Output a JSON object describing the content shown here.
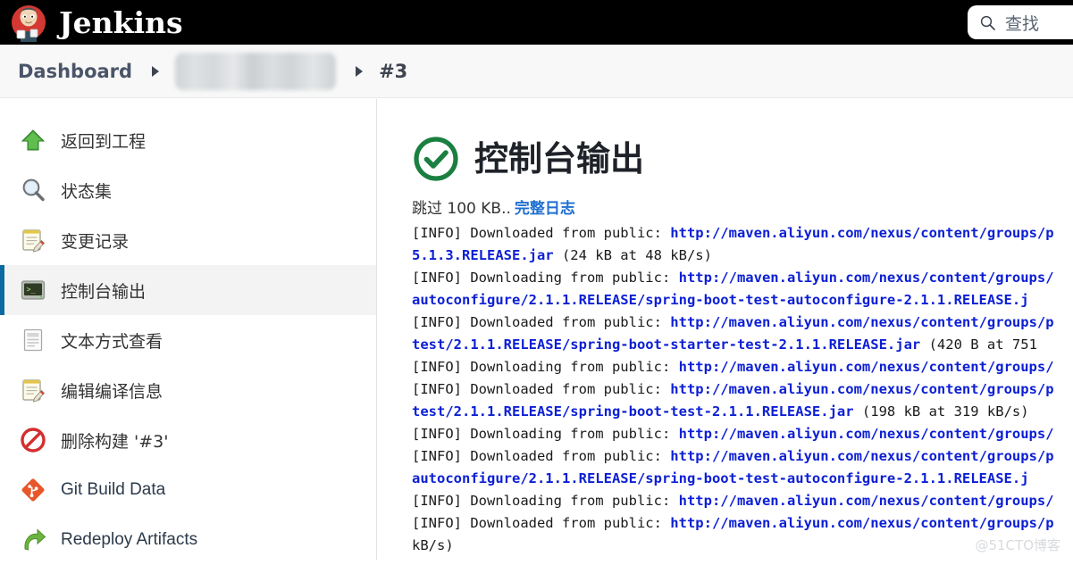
{
  "header": {
    "brand_title": "Jenkins",
    "logo_icon": "jenkins-butler-logo",
    "search_icon": "search-icon",
    "search_placeholder": "查找"
  },
  "breadcrumb": {
    "dashboard_label": "Dashboard",
    "project_label": "",
    "build_label": "#3"
  },
  "sidebar": {
    "items": [
      {
        "label": "返回到工程",
        "icon": "up-arrow-icon",
        "active": false
      },
      {
        "label": "状态集",
        "icon": "magnifier-icon",
        "active": false
      },
      {
        "label": "变更记录",
        "icon": "notepad-pencil-icon",
        "active": false
      },
      {
        "label": "控制台输出",
        "icon": "terminal-icon",
        "active": true
      },
      {
        "label": "文本方式查看",
        "icon": "document-icon",
        "active": false
      },
      {
        "label": "编辑编译信息",
        "icon": "notepad-pencil-icon",
        "active": false
      },
      {
        "label": "删除构建 '#3'",
        "icon": "no-entry-icon",
        "active": false
      },
      {
        "label": "Git Build Data",
        "icon": "git-diamond-icon",
        "active": false
      },
      {
        "label": "Redeploy Artifacts",
        "icon": "redeploy-arrow-icon",
        "active": false
      }
    ]
  },
  "console": {
    "status_icon": "success-check-circle-icon",
    "title": "控制台输出",
    "skip_text": "跳过 100 KB..",
    "full_log_label": "完整日志",
    "lines": [
      {
        "prefix": "[INFO] Downloaded from public: ",
        "url": "http://maven.aliyun.com/nexus/content/groups/p",
        "suffix": ""
      },
      {
        "prefix": "",
        "url": "5.1.3.RELEASE.jar",
        "suffix": " (24 kB at 48 kB/s)"
      },
      {
        "prefix": "[INFO] Downloading from public: ",
        "url": "http://maven.aliyun.com/nexus/content/groups/",
        "suffix": ""
      },
      {
        "prefix": "",
        "url": "autoconfigure/2.1.1.RELEASE/spring-boot-test-autoconfigure-2.1.1.RELEASE.j",
        "suffix": ""
      },
      {
        "prefix": "[INFO] Downloaded from public: ",
        "url": "http://maven.aliyun.com/nexus/content/groups/p",
        "suffix": ""
      },
      {
        "prefix": "",
        "url": "test/2.1.1.RELEASE/spring-boot-starter-test-2.1.1.RELEASE.jar",
        "suffix": " (420 B at 751"
      },
      {
        "prefix": "[INFO] Downloading from public: ",
        "url": "http://maven.aliyun.com/nexus/content/groups/",
        "suffix": ""
      },
      {
        "prefix": "[INFO] Downloaded from public: ",
        "url": "http://maven.aliyun.com/nexus/content/groups/p",
        "suffix": ""
      },
      {
        "prefix": "",
        "url": "test/2.1.1.RELEASE/spring-boot-test-2.1.1.RELEASE.jar",
        "suffix": " (198 kB at 319 kB/s)"
      },
      {
        "prefix": "[INFO] Downloading from public: ",
        "url": "http://maven.aliyun.com/nexus/content/groups/",
        "suffix": ""
      },
      {
        "prefix": "[INFO] Downloaded from public: ",
        "url": "http://maven.aliyun.com/nexus/content/groups/p",
        "suffix": ""
      },
      {
        "prefix": "",
        "url": "autoconfigure/2.1.1.RELEASE/spring-boot-test-autoconfigure-2.1.1.RELEASE.j",
        "suffix": ""
      },
      {
        "prefix": "[INFO] Downloading from public: ",
        "url": "http://maven.aliyun.com/nexus/content/groups/",
        "suffix": ""
      },
      {
        "prefix": "[INFO] Downloaded from public: ",
        "url": "http://maven.aliyun.com/nexus/content/groups/p",
        "suffix": ""
      },
      {
        "prefix": "kB/s)",
        "url": "",
        "suffix": ""
      }
    ]
  },
  "watermark": {
    "text": "@51CTO博客"
  },
  "colors": {
    "header_bg": "#000000",
    "accent_blue": "#0b6aa2",
    "link_blue": "#0c1fd4",
    "full_log_blue": "#1f6fd0",
    "success_green": "#1a7f40",
    "git_orange": "#e8562a",
    "sidebar_active_bg": "#f3f3f3"
  }
}
